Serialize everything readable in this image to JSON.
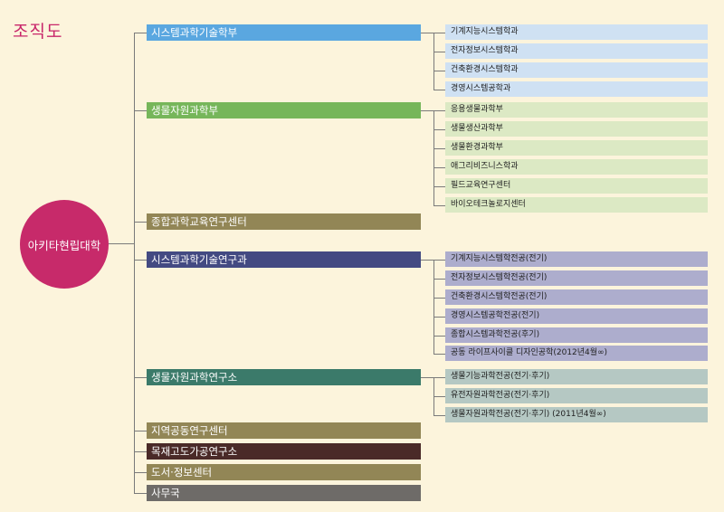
{
  "title": "조직도",
  "root": {
    "label": "아키타현립대학"
  },
  "units": [
    {
      "label": "시스템과학기술학부",
      "color": "#5aa7e0",
      "text_color": "#ffffff",
      "sub_color": "#cfe1f3",
      "children": [
        "기계지능시스템학과",
        "전자정보시스템학과",
        "건축환경시스템학과",
        "경영시스템공학과"
      ]
    },
    {
      "label": "생물자원과학부",
      "color": "#76b65a",
      "text_color": "#ffffff",
      "sub_color": "#dce9c4",
      "children": [
        "응용생물과학부",
        "생물생산과학부",
        "생물환경과학부",
        "애그리비즈니스학과",
        "필드교육연구센터",
        "바이오테크놀로지센터"
      ]
    },
    {
      "label": "종합과학교육연구센터",
      "color": "#928656",
      "text_color": "#ffffff",
      "children": []
    },
    {
      "label": "시스템과학기술연구과",
      "color": "#434a82",
      "text_color": "#ffffff",
      "sub_color": "#adadcd",
      "children": [
        "기계지능시스템학전공(전기)",
        "전자정보시스템학전공(전기)",
        "건축환경시스템학전공(전기)",
        "경영시스템공학전공(전기)",
        "종합시스템과학전공(후기)",
        "공동 라이프사이클 디자인공학(2012년4월∞)"
      ]
    },
    {
      "label": "생물자원과학연구소",
      "color": "#3b7a6a",
      "text_color": "#ffffff",
      "sub_color": "#b5c8c3",
      "children": [
        "생물기능과학전공(전기·후기)",
        "유전자원과학전공(전기·후기)",
        "생물자원과학전공(전기·후기) (2011년4월∞)"
      ]
    },
    {
      "label": "지역공동연구센터",
      "color": "#928656",
      "text_color": "#ffffff",
      "children": []
    },
    {
      "label": "목재고도가공연구소",
      "color": "#4a2a28",
      "text_color": "#ffffff",
      "children": []
    },
    {
      "label": "도서·정보센터",
      "color": "#928656",
      "text_color": "#ffffff",
      "children": []
    },
    {
      "label": "사무국",
      "color": "#6e6b68",
      "text_color": "#ffffff",
      "children": []
    }
  ]
}
